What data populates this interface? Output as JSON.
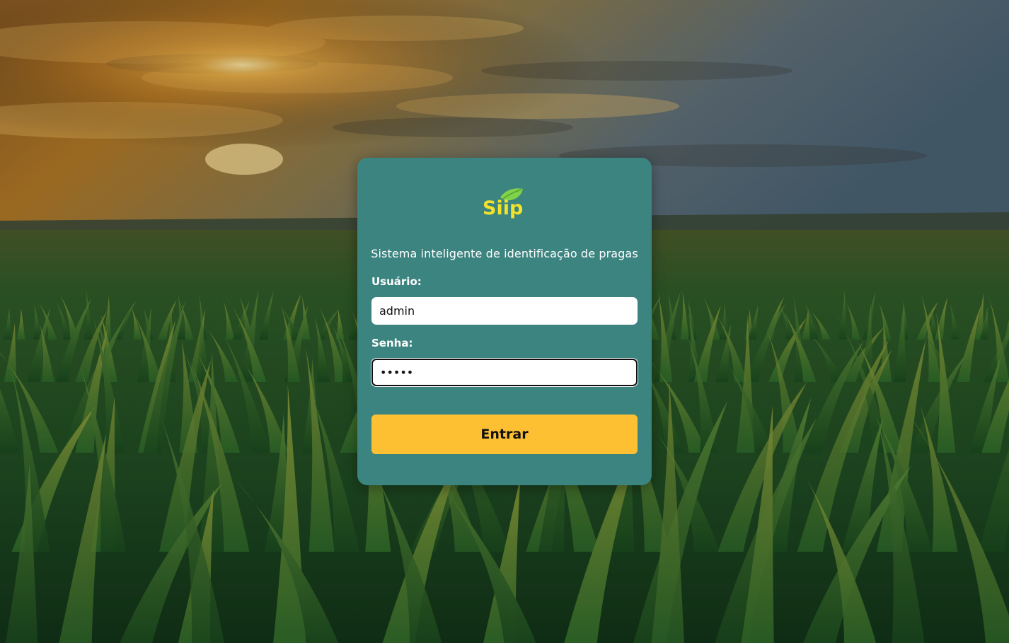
{
  "background": {
    "description_icon": "cornfield-sunset-image"
  },
  "login": {
    "logo_text": "Siip",
    "logo_icon": "leaf-icon",
    "subtitle": "Sistema inteligente de identificação de pragas",
    "username_label": "Usuário:",
    "username_value": "admin",
    "password_label": "Senha:",
    "password_value": "•••••",
    "submit_label": "Entrar"
  },
  "colors": {
    "card": "#3c8480",
    "button": "#fdc033",
    "logo_yellow": "#f2e32a",
    "logo_leaf": "#7fd24a"
  }
}
